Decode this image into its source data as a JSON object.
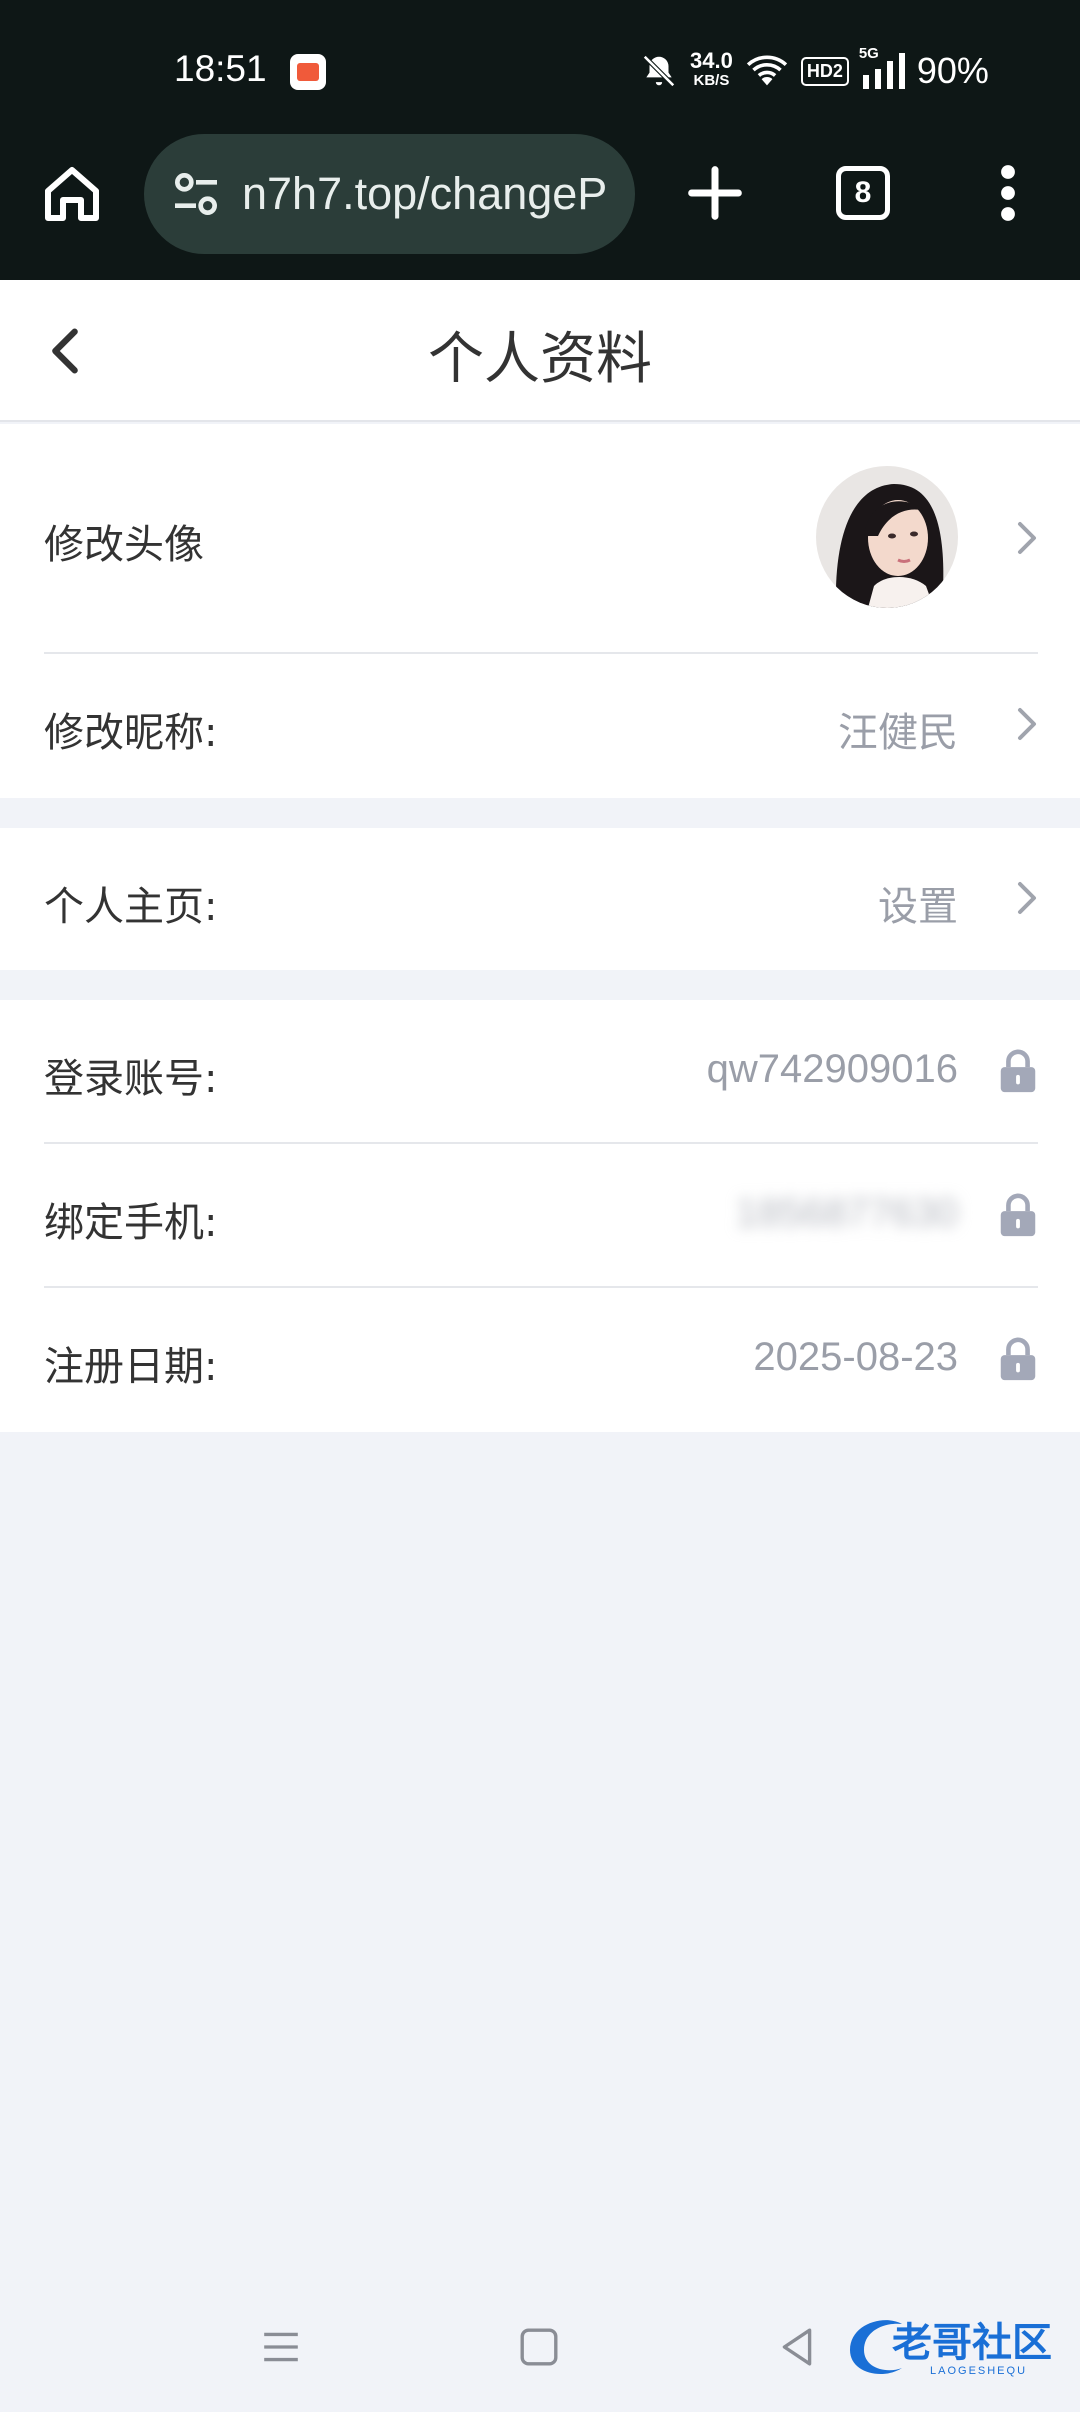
{
  "status_bar": {
    "time": "18:51",
    "net_speed": "34.0",
    "net_unit": "KB/S",
    "hd_label": "HD2",
    "signal_label": "5G",
    "battery": "90%"
  },
  "browser": {
    "url": "n7h7.top/changeP",
    "tab_count": "8"
  },
  "header": {
    "title": "个人资料"
  },
  "profile": {
    "avatar_label": "修改头像",
    "nickname_label": "修改昵称:",
    "nickname_value": "汪健民",
    "homepage_label": "个人主页:",
    "homepage_value": "设置",
    "account_label": "登录账号:",
    "account_value": "qw742909016",
    "phone_label": "绑定手机:",
    "phone_value": "1856877630",
    "register_label": "注册日期:",
    "register_value": "2025-08-23"
  },
  "watermark": {
    "text": "老哥社区",
    "subtext": "LAOGESHEQU"
  },
  "colors": {
    "chrome_bg": "#0e1716",
    "url_bar_bg": "#2b3d39",
    "page_bg": "#f1f3f8",
    "value_gray": "#9a9ea8",
    "lock_gray": "#a3a8b8",
    "watermark_blue": "#1a6fd6"
  }
}
